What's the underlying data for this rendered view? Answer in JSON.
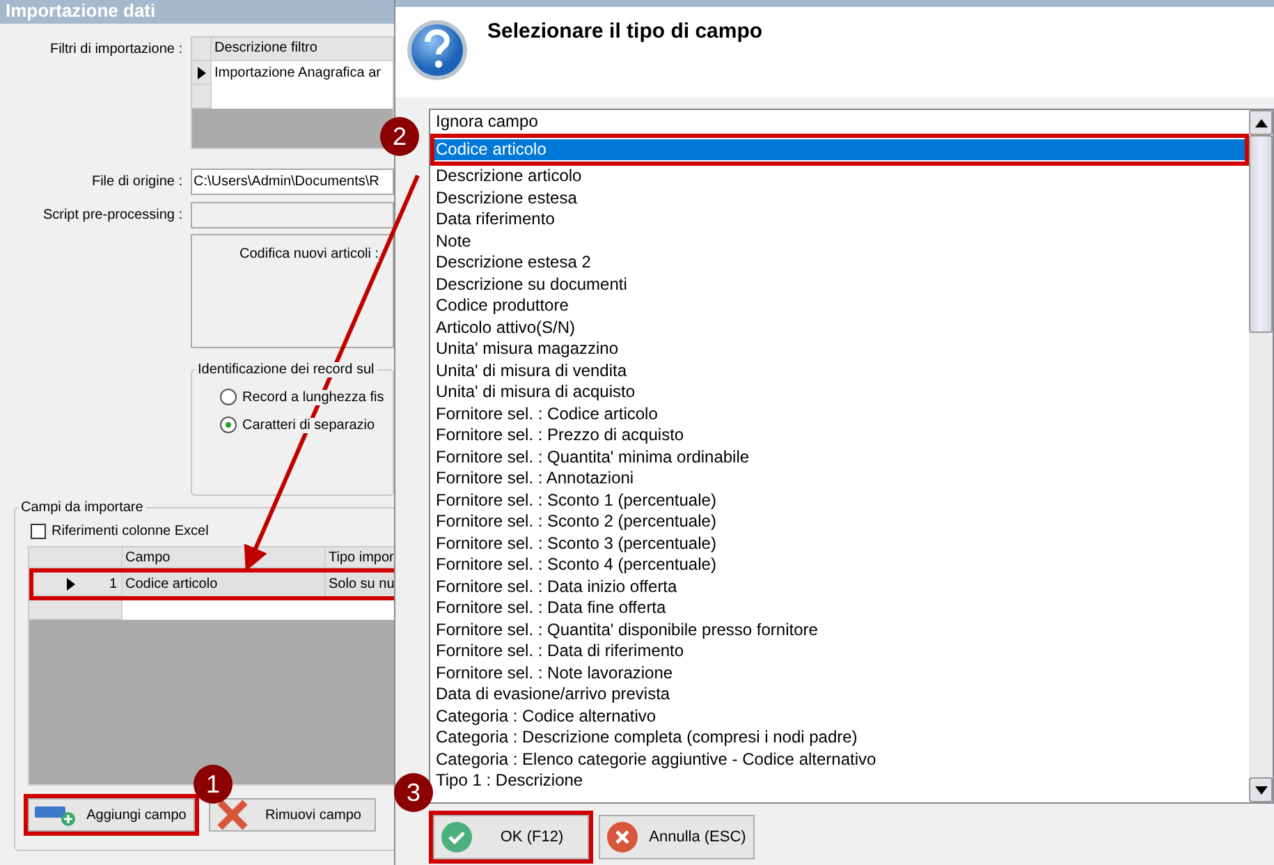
{
  "left_window": {
    "title": "Importazione dati",
    "filters": {
      "label": "Filtri di importazione :",
      "column": "Descrizione filtro",
      "rows": [
        {
          "text": "Importazione Anagrafica ar",
          "selected": true
        }
      ]
    },
    "source_file": {
      "label": "File di origine :",
      "value": "C:\\Users\\Admin\\Documents\\R"
    },
    "script": {
      "label": "Script pre-processing :"
    },
    "encoding": {
      "label": "Codifica nuovi articoli :"
    },
    "record_id": {
      "title": "Identificazione dei record sul",
      "options": [
        {
          "label": "Record a lunghezza fis",
          "selected": false
        },
        {
          "label": "Caratteri di separazio",
          "selected": true
        }
      ]
    },
    "fields": {
      "title": "Campi da importare",
      "excel_refs": {
        "label": "Riferimenti colonne Excel",
        "checked": false
      },
      "columns": [
        "Campo",
        "Tipo impor"
      ],
      "rows": [
        {
          "index": "1",
          "field": "Codice articolo",
          "type": "Solo su nu",
          "selected": true,
          "highlighted": true
        }
      ],
      "buttons": [
        {
          "kind": "add",
          "label": "Aggiungi campo",
          "highlighted": true
        },
        {
          "kind": "remove",
          "label": "Rimuovi campo",
          "highlighted": false
        }
      ]
    }
  },
  "dialog": {
    "title": "Selezionare il tipo di campo",
    "items": [
      {
        "label": "Ignora campo",
        "selected": false,
        "highlighted": false
      },
      {
        "label": "Codice articolo",
        "selected": true,
        "highlighted": true
      },
      {
        "label": "Descrizione articolo",
        "selected": false,
        "highlighted": false
      },
      {
        "label": "Descrizione estesa",
        "selected": false,
        "highlighted": false
      },
      {
        "label": "Data riferimento",
        "selected": false,
        "highlighted": false
      },
      {
        "label": "Note",
        "selected": false,
        "highlighted": false
      },
      {
        "label": "Descrizione estesa 2",
        "selected": false,
        "highlighted": false
      },
      {
        "label": "Descrizione su documenti",
        "selected": false,
        "highlighted": false
      },
      {
        "label": "Codice produttore",
        "selected": false,
        "highlighted": false
      },
      {
        "label": "Articolo attivo(S/N)",
        "selected": false,
        "highlighted": false
      },
      {
        "label": "Unita' misura magazzino",
        "selected": false,
        "highlighted": false
      },
      {
        "label": "Unita' di misura di vendita",
        "selected": false,
        "highlighted": false
      },
      {
        "label": "Unita' di misura di acquisto",
        "selected": false,
        "highlighted": false
      },
      {
        "label": "Fornitore sel. : Codice articolo",
        "selected": false,
        "highlighted": false
      },
      {
        "label": "Fornitore sel. : Prezzo di acquisto",
        "selected": false,
        "highlighted": false
      },
      {
        "label": "Fornitore sel. : Quantita' minima ordinabile",
        "selected": false,
        "highlighted": false
      },
      {
        "label": "Fornitore sel. : Annotazioni",
        "selected": false,
        "highlighted": false
      },
      {
        "label": "Fornitore sel. : Sconto 1 (percentuale)",
        "selected": false,
        "highlighted": false
      },
      {
        "label": "Fornitore sel. : Sconto 2 (percentuale)",
        "selected": false,
        "highlighted": false
      },
      {
        "label": "Fornitore sel. : Sconto 3 (percentuale)",
        "selected": false,
        "highlighted": false
      },
      {
        "label": "Fornitore sel. : Sconto 4 (percentuale)",
        "selected": false,
        "highlighted": false
      },
      {
        "label": "Fornitore sel. : Data inizio offerta",
        "selected": false,
        "highlighted": false
      },
      {
        "label": "Fornitore sel. : Data fine offerta",
        "selected": false,
        "highlighted": false
      },
      {
        "label": "Fornitore sel. : Quantita' disponibile presso fornitore",
        "selected": false,
        "highlighted": false
      },
      {
        "label": "Fornitore sel. : Data di riferimento",
        "selected": false,
        "highlighted": false
      },
      {
        "label": "Fornitore sel. : Note lavorazione",
        "selected": false,
        "highlighted": false
      },
      {
        "label": "Data di evasione/arrivo prevista",
        "selected": false,
        "highlighted": false
      },
      {
        "label": "Categoria : Codice alternativo",
        "selected": false,
        "highlighted": false
      },
      {
        "label": "Categoria : Descrizione completa (compresi i nodi padre)",
        "selected": false,
        "highlighted": false
      },
      {
        "label": "Categoria : Elenco categorie aggiuntive - Codice alternativo",
        "selected": false,
        "highlighted": false
      },
      {
        "label": "Tipo 1 : Descrizione",
        "selected": false,
        "highlighted": false
      }
    ],
    "buttons": [
      {
        "kind": "ok",
        "label": "OK (F12)",
        "highlighted": true
      },
      {
        "kind": "cancel",
        "label": "Annulla (ESC)",
        "highlighted": false
      }
    ]
  },
  "annotations": [
    {
      "label": "1"
    },
    {
      "label": "2"
    },
    {
      "label": "3"
    }
  ]
}
